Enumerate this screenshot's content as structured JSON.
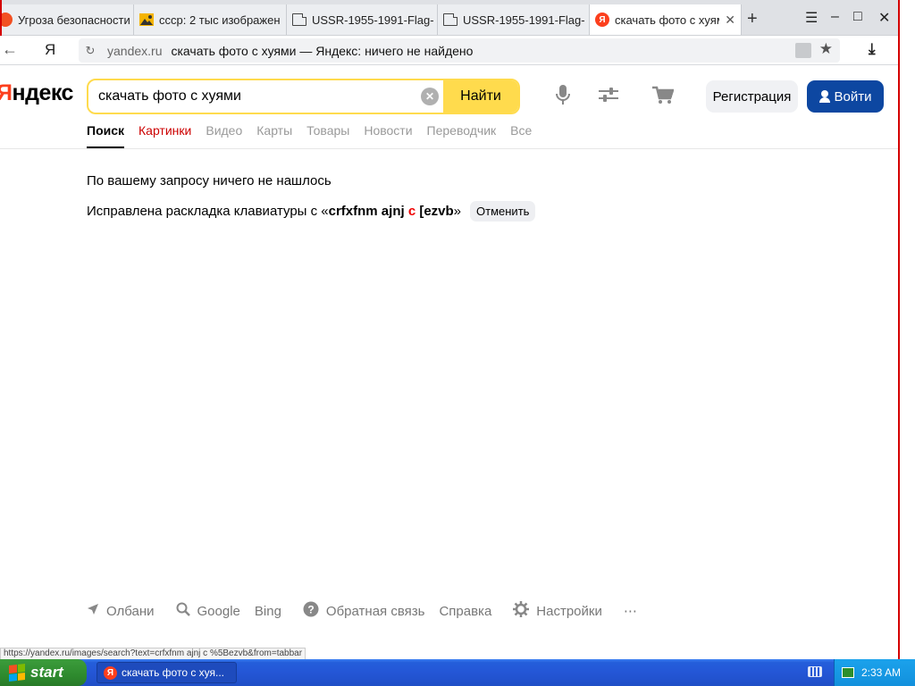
{
  "tabs": [
    {
      "label": "Угроза безопасности",
      "icon": "warning-icon"
    },
    {
      "label": "ссср: 2 тыс изображен",
      "icon": "images-icon"
    },
    {
      "label": "USSR-1955-1991-Flag-",
      "icon": "document-icon"
    },
    {
      "label": "USSR-1955-1991-Flag-",
      "icon": "document-icon"
    },
    {
      "label": "скачать фото с хуям",
      "icon": "yandex-icon",
      "active": true
    }
  ],
  "tab_yandex_letter": "Я",
  "new_tab_symbol": "+",
  "window_controls": {
    "menu": "☰",
    "minimize": "–",
    "maximize": "□",
    "close": "✕"
  },
  "addressbar": {
    "back_symbol": "←",
    "browser_logo": "Я",
    "reload_symbol": "↻",
    "domain": "yandex.ru",
    "title": "скачать фото с хуями — Яндекс: ничего не найдено",
    "star_symbol": "★",
    "download_symbol": "⤓"
  },
  "header": {
    "logo_first": "Я",
    "logo_rest": "ндекс",
    "search_value": "скачать фото с хуями",
    "clear_symbol": "✕",
    "search_button": "Найти",
    "register_button": "Регистрация",
    "login_button": "Войти"
  },
  "nav_tabs": [
    "Поиск",
    "Картинки",
    "Видео",
    "Карты",
    "Товары",
    "Новости",
    "Переводчик",
    "Все"
  ],
  "results": {
    "no_results": "По вашему запросу ничего не нашлось",
    "fix_prefix": "Исправлена раскладка клавиатуры с «",
    "fix_part1": "crfxfnm ajnj ",
    "fix_part2": "c",
    "fix_part3": " [ezvb",
    "fix_suffix": "»",
    "cancel_button": "Отменить"
  },
  "footer": {
    "region": "Олбани",
    "google": "Google",
    "bing": "Bing",
    "feedback": "Обратная связь",
    "help": "Справка",
    "settings": "Настройки",
    "more": "⋯"
  },
  "status_url": "https://yandex.ru/images/search?text=crfxfnm ajnj c %5Bezvb&from=tabbar",
  "taskbar": {
    "start_label": "start",
    "task_label": "скачать фото с хуя...",
    "clock": "2:33 AM"
  },
  "colors": {
    "yandex_red": "#fc3f1d",
    "search_yellow": "#ffdb4d",
    "login_blue": "#0d47a1",
    "xp_taskbar_blue": "#245edb",
    "xp_start_green": "#2e8b2e"
  }
}
